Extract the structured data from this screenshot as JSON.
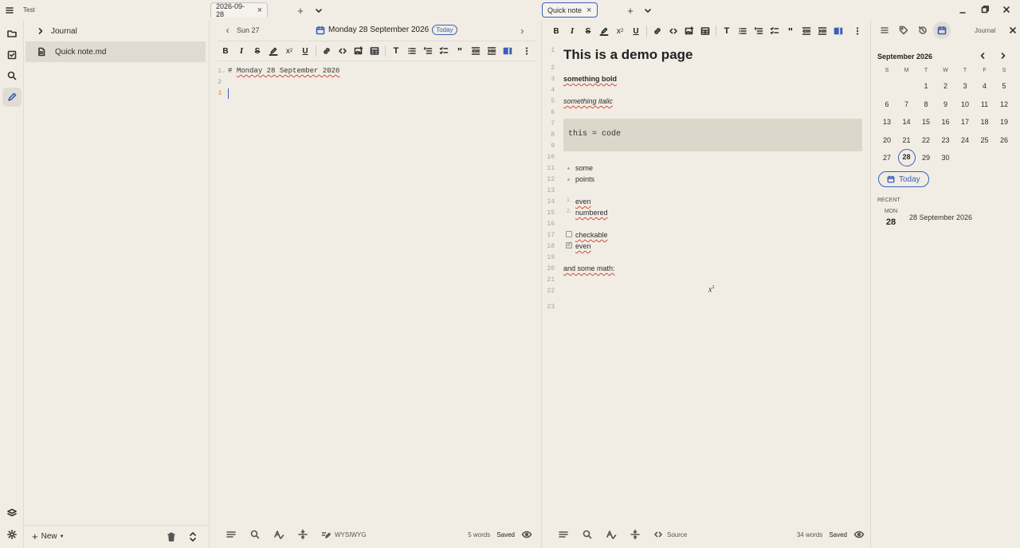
{
  "window": {
    "title": "Test"
  },
  "activity": {
    "items": [
      "folder-icon",
      "checklist-icon",
      "search-icon",
      "pencil-icon"
    ],
    "bottom": [
      "layers-icon",
      "gear-icon"
    ]
  },
  "sidebar": {
    "tree": [
      {
        "label": "Journal",
        "type": "folder"
      },
      {
        "label": "Quick note.md",
        "type": "file",
        "selected": true
      }
    ],
    "new_label": "New"
  },
  "pane1": {
    "tab": "2026-09-28",
    "nav_prev": "Sun 27",
    "date_title": "Monday 28 September 2026",
    "today_badge": "Today",
    "lines": [
      "# Monday 28 September 2026",
      "",
      ""
    ],
    "line_numbers": [
      "1",
      "2",
      "3"
    ],
    "status": {
      "mode": "WYSIWYG",
      "words": "5 words",
      "saved": "Saved"
    }
  },
  "pane2": {
    "tab": "Quick note",
    "line_numbers": [
      "1",
      "2",
      "3",
      "4",
      "5",
      "6",
      "7",
      "8",
      "9",
      "10",
      "11",
      "12",
      "13",
      "14",
      "15",
      "16",
      "17",
      "18",
      "19",
      "20",
      "21",
      "22",
      "23"
    ],
    "heading": "This is a demo page",
    "bold": "something bold",
    "italic": "something italic",
    "code": "this = code",
    "bullets": [
      "some",
      "points"
    ],
    "numbered": [
      {
        "n": "1.",
        "text": "even"
      },
      {
        "n": "2.",
        "text": "numbered"
      }
    ],
    "checks": [
      {
        "text": "checkable",
        "checked": false
      },
      {
        "text": "even",
        "checked": true
      }
    ],
    "math_label": "and some math:",
    "math_base": "x",
    "math_exp": "2",
    "status": {
      "mode": "Source",
      "words": "34 words",
      "saved": "Saved"
    }
  },
  "pane3": {
    "header_label": "Journal",
    "month": "September 2026",
    "weekdays": [
      "S",
      "M",
      "T",
      "W",
      "T",
      "F",
      "S"
    ],
    "weeks": [
      [
        "",
        "",
        "1",
        "2",
        "3",
        "4",
        "5"
      ],
      [
        "6",
        "7",
        "8",
        "9",
        "10",
        "11",
        "12"
      ],
      [
        "13",
        "14",
        "15",
        "16",
        "17",
        "18",
        "19"
      ],
      [
        "20",
        "21",
        "22",
        "23",
        "24",
        "25",
        "26"
      ],
      [
        "27",
        "28",
        "29",
        "30",
        "",
        "",
        ""
      ]
    ],
    "selected_day": "28",
    "today_button": "Today",
    "recent_label": "RECENT",
    "recent": [
      {
        "dow": "MON",
        "day": "28",
        "title": "28 September 2026"
      }
    ]
  },
  "colors": {
    "accent": "#3a5fb8",
    "bg": "#f1ede5",
    "code_bg": "#ddd6ca",
    "selection": "#dfdbd3"
  }
}
